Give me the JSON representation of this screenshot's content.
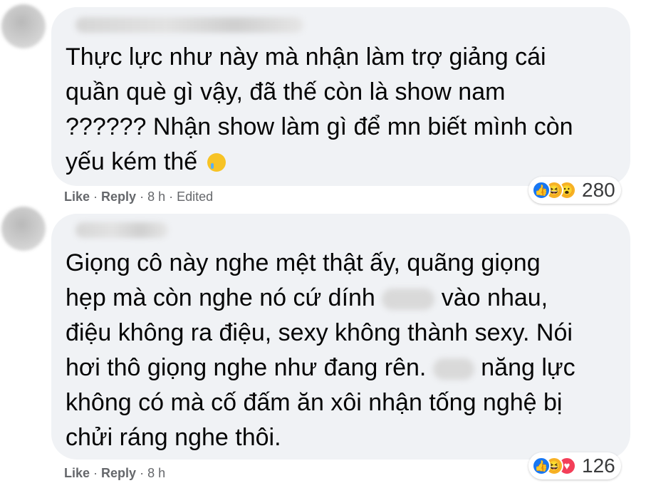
{
  "comments": [
    {
      "text_lines": [
        "Thực lực như này mà nhận làm trợ giảng cái",
        "quần què gì vậy, đã thế còn là show nam",
        "?????? Nhận show làm gì để mn biết mình còn",
        "yếu kém thế"
      ],
      "emoji": "crying-face",
      "actions": {
        "like": "Like",
        "reply": "Reply",
        "time": "8 h",
        "edited": "Edited"
      },
      "reactions": {
        "types": [
          "like",
          "haha",
          "wow"
        ],
        "count": "280"
      }
    },
    {
      "text_lines": [
        "Giọng cô này nghe mệt thật ấy, quãng giọng",
        "hẹp mà còn nghe nó cứ dính",
        "vào nhau,",
        "điệu không ra điệu, sexy không thành sexy. Nói",
        "hơi thô giọng nghe như đang rên.",
        "năng lực",
        "không có mà cố đấm ăn xôi nhận tống nghệ bị",
        "chửi ráng nghe thôi."
      ],
      "actions": {
        "like": "Like",
        "reply": "Reply",
        "time": "8 h"
      },
      "reactions": {
        "types": [
          "like",
          "haha",
          "love"
        ],
        "count": "126"
      }
    }
  ],
  "colors": {
    "bubble": "#f0f2f5",
    "like": "#1877f2",
    "haha": "#f7b125",
    "love": "#f33e58",
    "meta": "#65676b"
  }
}
